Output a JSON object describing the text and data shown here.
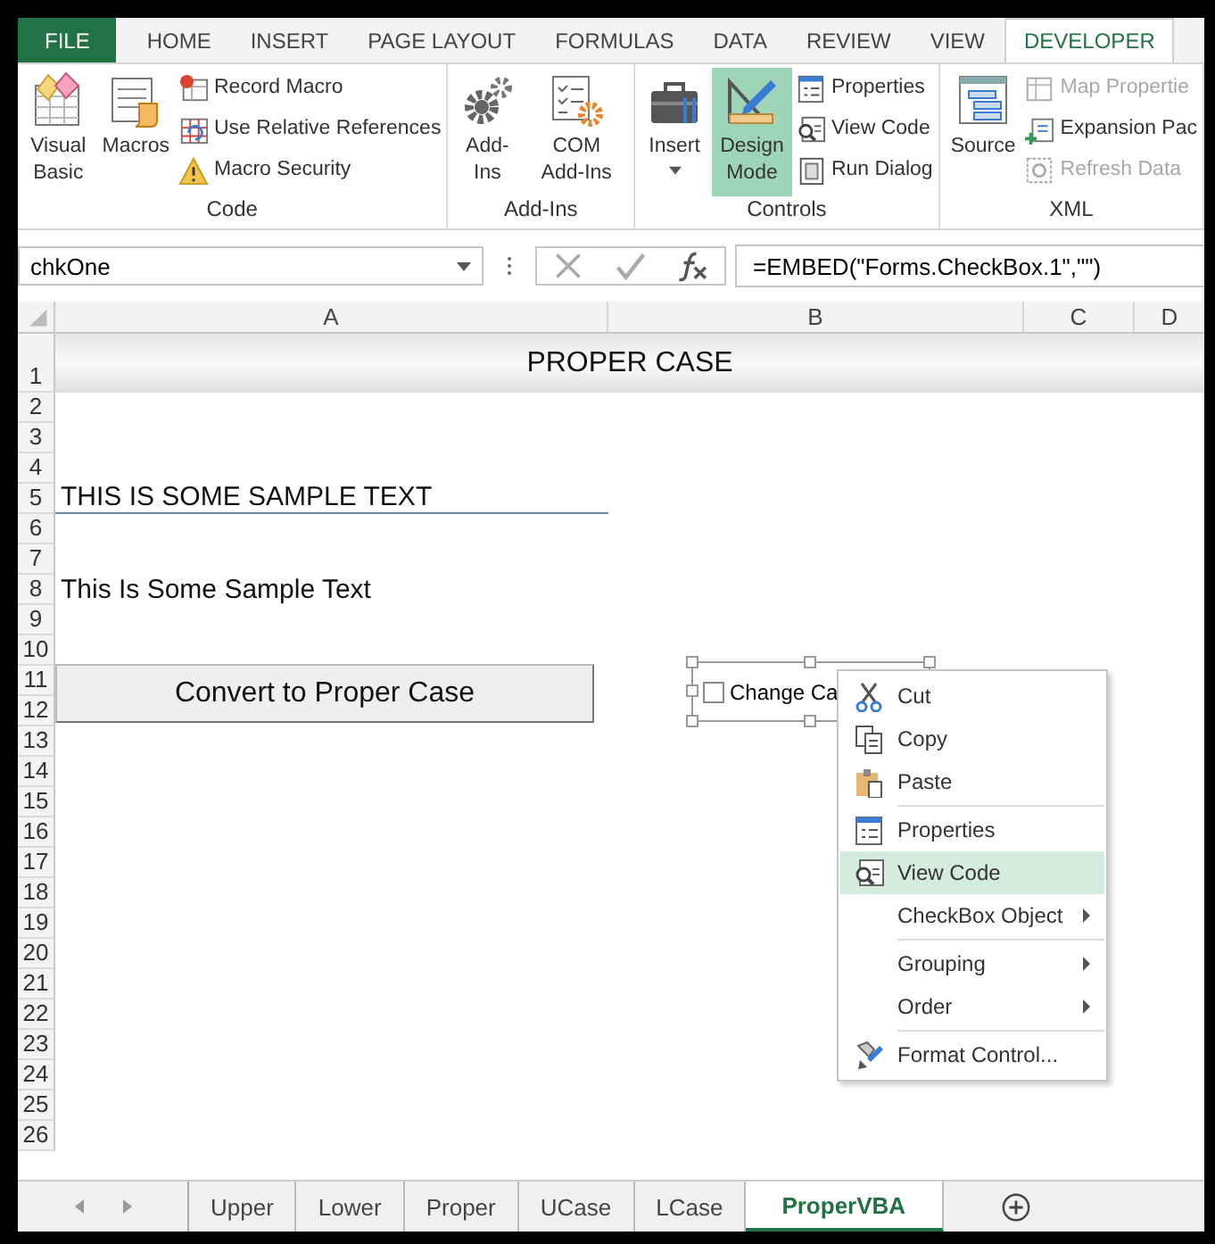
{
  "ribbon_tabs": [
    {
      "label": "FILE",
      "kind": "file",
      "selected": false
    },
    {
      "label": "HOME",
      "kind": "tab",
      "selected": false
    },
    {
      "label": "INSERT",
      "kind": "tab",
      "selected": false
    },
    {
      "label": "PAGE LAYOUT",
      "kind": "tab",
      "selected": false
    },
    {
      "label": "FORMULAS",
      "kind": "tab",
      "selected": false
    },
    {
      "label": "DATA",
      "kind": "tab",
      "selected": false
    },
    {
      "label": "REVIEW",
      "kind": "tab",
      "selected": false
    },
    {
      "label": "VIEW",
      "kind": "tab",
      "selected": false
    },
    {
      "label": "DEVELOPER",
      "kind": "tab",
      "selected": true
    }
  ],
  "ribbon_groups": [
    {
      "label": "Code",
      "items": [
        {
          "kind": "large",
          "label": "Visual Basic",
          "on": false,
          "dropdown": false
        },
        {
          "kind": "large",
          "label": "Macros",
          "on": false,
          "dropdown": false
        },
        {
          "kind": "stack",
          "items": [
            {
              "label": "Record Macro",
              "disabled": false
            },
            {
              "label": "Use Relative References",
              "disabled": false
            },
            {
              "label": "Macro Security",
              "disabled": false
            }
          ]
        }
      ]
    },
    {
      "label": "Add-Ins",
      "items": [
        {
          "kind": "large",
          "label": "Add-Ins",
          "on": false,
          "dropdown": false
        },
        {
          "kind": "large",
          "label": "COM Add-Ins",
          "on": false,
          "dropdown": false
        }
      ]
    },
    {
      "label": "Controls",
      "items": [
        {
          "kind": "large",
          "label": "Insert",
          "on": false,
          "dropdown": true
        },
        {
          "kind": "large",
          "label": "Design Mode",
          "on": true,
          "dropdown": false
        },
        {
          "kind": "stack",
          "items": [
            {
              "label": "Properties",
              "disabled": false
            },
            {
              "label": "View Code",
              "disabled": false
            },
            {
              "label": "Run Dialog",
              "disabled": false
            }
          ]
        }
      ]
    },
    {
      "label": "XML",
      "items": [
        {
          "kind": "large",
          "label": "Source",
          "on": false,
          "dropdown": false
        },
        {
          "kind": "stack",
          "items": [
            {
              "label": "Map Propertie",
              "disabled": true
            },
            {
              "label": "Expansion Pac",
              "disabled": false
            },
            {
              "label": "Refresh Data",
              "disabled": true
            }
          ]
        }
      ]
    }
  ],
  "name_box": "chkOne",
  "formula": "=EMBED(\"Forms.CheckBox.1\",\"\")",
  "columns": [
    "A",
    "B",
    "C",
    "D"
  ],
  "rows": [
    {
      "number": "1",
      "kind": "title",
      "text": "PROPER CASE"
    },
    {
      "number": "2",
      "kind": "empty"
    },
    {
      "number": "3",
      "kind": "empty"
    },
    {
      "number": "4",
      "kind": "empty"
    },
    {
      "number": "5",
      "kind": "underlined",
      "text": "THIS IS SOME SAMPLE TEXT"
    },
    {
      "number": "6",
      "kind": "empty"
    },
    {
      "number": "7",
      "kind": "empty"
    },
    {
      "number": "8",
      "kind": "plain",
      "text": "This Is Some Sample Text"
    },
    {
      "number": "9",
      "kind": "empty"
    },
    {
      "number": "10",
      "kind": "empty"
    },
    {
      "number": "11",
      "kind": "empty"
    },
    {
      "number": "12",
      "kind": "empty"
    },
    {
      "number": "13",
      "kind": "empty"
    },
    {
      "number": "14",
      "kind": "empty"
    },
    {
      "number": "15",
      "kind": "empty"
    },
    {
      "number": "16",
      "kind": "empty"
    },
    {
      "number": "17",
      "kind": "empty"
    },
    {
      "number": "18",
      "kind": "empty"
    },
    {
      "number": "19",
      "kind": "empty"
    },
    {
      "number": "20",
      "kind": "empty"
    },
    {
      "number": "21",
      "kind": "empty"
    },
    {
      "number": "22",
      "kind": "empty"
    },
    {
      "number": "23",
      "kind": "empty"
    },
    {
      "number": "24",
      "kind": "empty"
    },
    {
      "number": "25",
      "kind": "empty"
    },
    {
      "number": "26",
      "kind": "empty"
    }
  ],
  "sheet_button": "Convert to Proper Case",
  "checkbox": {
    "label": "Change Ca",
    "checked": false
  },
  "context_menu": [
    {
      "label": "Cut",
      "kind": "item",
      "selected": false,
      "separator_before": false
    },
    {
      "label": "Copy",
      "kind": "item",
      "selected": false,
      "separator_before": false
    },
    {
      "label": "Paste",
      "kind": "item",
      "selected": false,
      "separator_before": false
    },
    {
      "label": "Properties",
      "kind": "item",
      "selected": false,
      "separator_before": true
    },
    {
      "label": "View Code",
      "kind": "item",
      "selected": true,
      "separator_before": false
    },
    {
      "label": "CheckBox Object",
      "kind": "submenu",
      "selected": false,
      "separator_before": false
    },
    {
      "label": "Grouping",
      "kind": "submenu",
      "selected": false,
      "separator_before": true
    },
    {
      "label": "Order",
      "kind": "submenu",
      "selected": false,
      "separator_before": false
    },
    {
      "label": "Format Control...",
      "kind": "item",
      "selected": false,
      "separator_before": true
    }
  ],
  "sheet_tabs": [
    {
      "label": "Upper",
      "selected": false
    },
    {
      "label": "Lower",
      "selected": false
    },
    {
      "label": "Proper",
      "selected": false
    },
    {
      "label": "UCase",
      "selected": false
    },
    {
      "label": "LCase",
      "selected": false
    },
    {
      "label": "ProperVBA",
      "selected": true
    }
  ]
}
